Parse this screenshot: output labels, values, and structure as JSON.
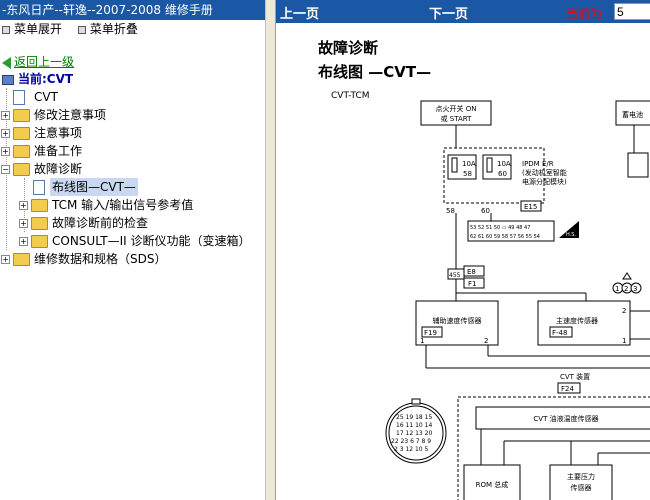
{
  "left_pane": {
    "title": "-东风日产--轩逸--2007-2008 维修手册",
    "menu_expand": "菜单展开",
    "menu_collapse": "菜单折叠",
    "back_link": "返回上一级",
    "current_label": "当前:CVT",
    "tree": [
      {
        "label": "CVT"
      },
      {
        "label": "修改注意事项"
      },
      {
        "label": "注意事项"
      },
      {
        "label": "准备工作"
      },
      {
        "label": "故障诊断"
      },
      {
        "label": "布线图—CVT—"
      },
      {
        "label": "TCM 输入/输出信号参考值"
      },
      {
        "label": "故障诊断前的检查"
      },
      {
        "label": "CONSULT—II 诊断仪功能（变速箱）"
      },
      {
        "label": "维修数据和规格（SDS）"
      }
    ]
  },
  "nav": {
    "prev": "上一页",
    "next": "下一页",
    "current_page_label": "当前为",
    "current_page_value": "5"
  },
  "doc": {
    "heading1": "故障诊断",
    "heading2": "布线图 —CVT—",
    "diagram": {
      "title": "CVT-TCM",
      "ign_switch": [
        "点火开关 ON",
        "或 START"
      ],
      "battery": "蓄电池",
      "ipdm_title": "IPDM E/R",
      "ipdm_desc": [
        "(发动机室智能",
        "电源分配模块)"
      ],
      "fuse1": [
        "10A",
        "58"
      ],
      "fuse2": [
        "10A",
        "60"
      ],
      "pin_58": "58",
      "pin_60": "60",
      "conn_e15": "E15",
      "conn_row1": [
        "53",
        "52",
        "51",
        "50",
        "",
        "49",
        "48",
        "47"
      ],
      "conn_row2": [
        "62",
        "61",
        "60",
        "59",
        "58",
        "57",
        "56",
        "55",
        "54"
      ],
      "hs": "H.S.",
      "pin_455": "455",
      "conn_e8": "E8",
      "conn_f1": "F1",
      "marker_1": "1",
      "marker_2": "2",
      "marker_3": "3",
      "pin_3a": "3",
      "pin_3b": "3",
      "pin_2": "2",
      "sensor_aux": "辅助速度传感器",
      "conn_f19": "F19",
      "sensor_main": "主速度传感器",
      "conn_f48": "F-48",
      "pin_1a": "1",
      "pin_2a": "2",
      "pin_1b": "1",
      "cvt_device": "CVT 装置",
      "conn_f24": "F24",
      "oil_temp": "CVT 油液温度传感器",
      "rom": "ROM 总成",
      "pressure": [
        "主要压力",
        "传感器"
      ],
      "round_conn": [
        [
          "25",
          "19",
          "18",
          "15"
        ],
        [
          "16",
          "11",
          "10",
          "14"
        ],
        [
          "17",
          "12",
          "13",
          "20"
        ],
        [
          "22",
          "23",
          "6",
          "7",
          "8",
          "9"
        ],
        [
          "2",
          "3",
          "12",
          "10",
          "5"
        ]
      ]
    }
  }
}
